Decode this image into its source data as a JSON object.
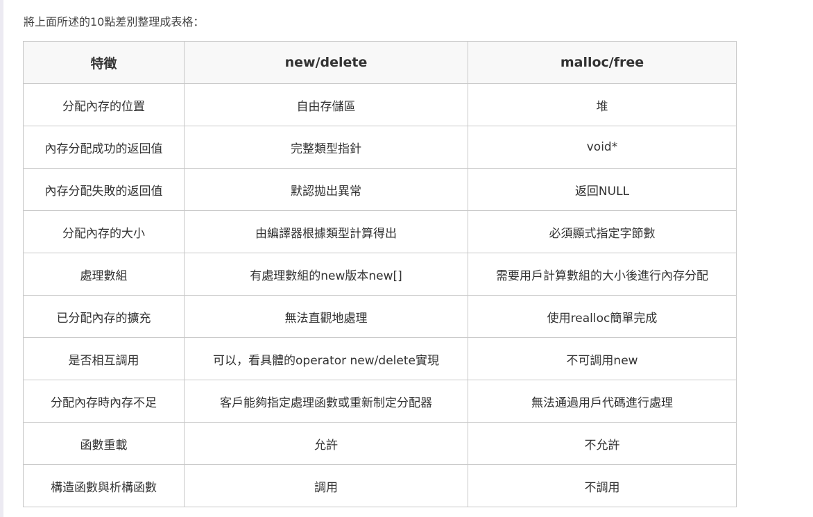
{
  "intro": "將上面所述的10點差別整理成表格：",
  "table": {
    "headers": [
      "特徵",
      "new/delete",
      "malloc/free"
    ],
    "rows": [
      [
        "分配內存的位置",
        "自由存儲區",
        "堆"
      ],
      [
        "內存分配成功的返回值",
        "完整類型指針",
        "void*"
      ],
      [
        "內存分配失敗的返回值",
        "默認拋出異常",
        "返回NULL"
      ],
      [
        "分配內存的大小",
        "由編譯器根據類型計算得出",
        "必須顯式指定字節數"
      ],
      [
        "處理數組",
        "有處理數組的new版本new[]",
        "需要用戶計算數組的大小後進行內存分配"
      ],
      [
        "已分配內存的擴充",
        "無法直觀地處理",
        "使用realloc簡單完成"
      ],
      [
        "是否相互調用",
        "可以，看具體的operator new/delete實現",
        "不可調用new"
      ],
      [
        "分配內存時內存不足",
        "客戶能夠指定處理函數或重新制定分配器",
        "無法通過用戶代碼進行處理"
      ],
      [
        "函數重載",
        "允許",
        "不允許"
      ],
      [
        "構造函數與析構函數",
        "調用",
        "不調用"
      ]
    ]
  }
}
